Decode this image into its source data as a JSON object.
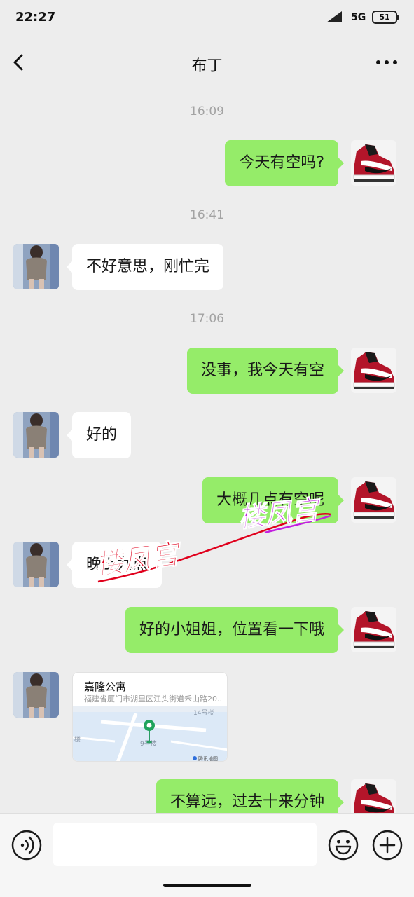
{
  "status_bar": {
    "time": "22:27",
    "network": "5G",
    "battery": "51"
  },
  "header": {
    "title": "布丁"
  },
  "messages": [
    {
      "kind": "timestamp",
      "text": "16:09"
    },
    {
      "kind": "text",
      "side": "right",
      "text": "今天有空吗?"
    },
    {
      "kind": "timestamp",
      "text": "16:41"
    },
    {
      "kind": "text",
      "side": "left",
      "text": "不好意思，刚忙完"
    },
    {
      "kind": "timestamp",
      "text": "17:06"
    },
    {
      "kind": "text",
      "side": "right",
      "text": "没事，我今天有空"
    },
    {
      "kind": "text",
      "side": "left",
      "text": "好的"
    },
    {
      "kind": "text",
      "side": "right",
      "text": "大概几点有空呢"
    },
    {
      "kind": "text",
      "side": "left",
      "text": "晚上九点"
    },
    {
      "kind": "text",
      "side": "right",
      "text": "好的小姐姐，位置看一下哦"
    },
    {
      "kind": "location",
      "side": "left",
      "name": "嘉隆公寓",
      "address": "福建省厦门市湖里区江头街道禾山路20...",
      "map_labels": [
        "14号楼",
        "9号楼",
        "楼"
      ],
      "map_source": "腾讯地图"
    },
    {
      "kind": "text",
      "side": "right",
      "text": "不算远，过去十来分钟"
    }
  ],
  "watermark": {
    "text_left": "楼凤宫",
    "text_right": "楼凤宫"
  },
  "input": {
    "placeholder": ""
  },
  "colors": {
    "bubble_sent": "#95ec69",
    "bubble_received": "#ffffff",
    "background": "#ededed",
    "watermark_red": "#e0001c",
    "watermark_purple": "#c21fe0"
  }
}
